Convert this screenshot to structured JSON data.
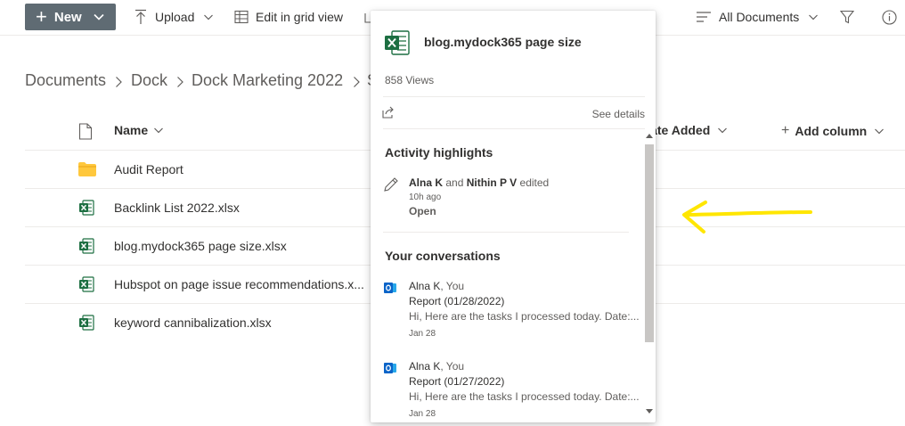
{
  "toolbar": {
    "new_label": "New",
    "upload_label": "Upload",
    "grid_label": "Edit in grid view",
    "view_label": "All Documents"
  },
  "breadcrumb": {
    "items": [
      "Documents",
      "Dock",
      "Dock Marketing 2022",
      "S"
    ]
  },
  "list": {
    "columns": {
      "name": "Name",
      "date_added": "Date Added",
      "add_column": "Add column"
    },
    "rows": [
      {
        "name": "Audit Report",
        "type": "folder-icon"
      },
      {
        "name": "Backlink List 2022.xlsx",
        "type": "excel-icon"
      },
      {
        "name": "blog.mydock365 page size.xlsx",
        "type": "excel-icon"
      },
      {
        "name": "Hubspot on page issue recommendations.x...",
        "type": "excel-icon"
      },
      {
        "name": "keyword cannibalization.xlsx",
        "type": "excel-icon"
      }
    ]
  },
  "callout": {
    "title": "blog.mydock365 page size",
    "views": "858 Views",
    "see_details": "See details",
    "activity_heading": "Activity highlights",
    "activity": {
      "user1": "Alna K",
      "and": "and",
      "user2": "Nithin P V",
      "action": "edited",
      "time": "10h ago",
      "open": "Open"
    },
    "conversations_heading": "Your conversations",
    "conversations": [
      {
        "people_bold": "Alna K",
        "people_rest": ", You",
        "subject": "Report (01/28/2022)",
        "preview": "Hi, Here are the tasks I processed today. Date:...",
        "date": "Jan 28"
      },
      {
        "people_bold": "Alna K",
        "people_rest": ", You",
        "subject": "Report (01/27/2022)",
        "preview": "Hi, Here are the tasks I processed today. Date:...",
        "date": "Jan 28"
      }
    ]
  },
  "colors": {
    "new_button": "#5f6b73",
    "excel_green": "#1d6f42",
    "folder_yellow": "#ffc83d",
    "outlook_blue": "#0a64c8",
    "arrow_yellow": "#ffe600"
  }
}
